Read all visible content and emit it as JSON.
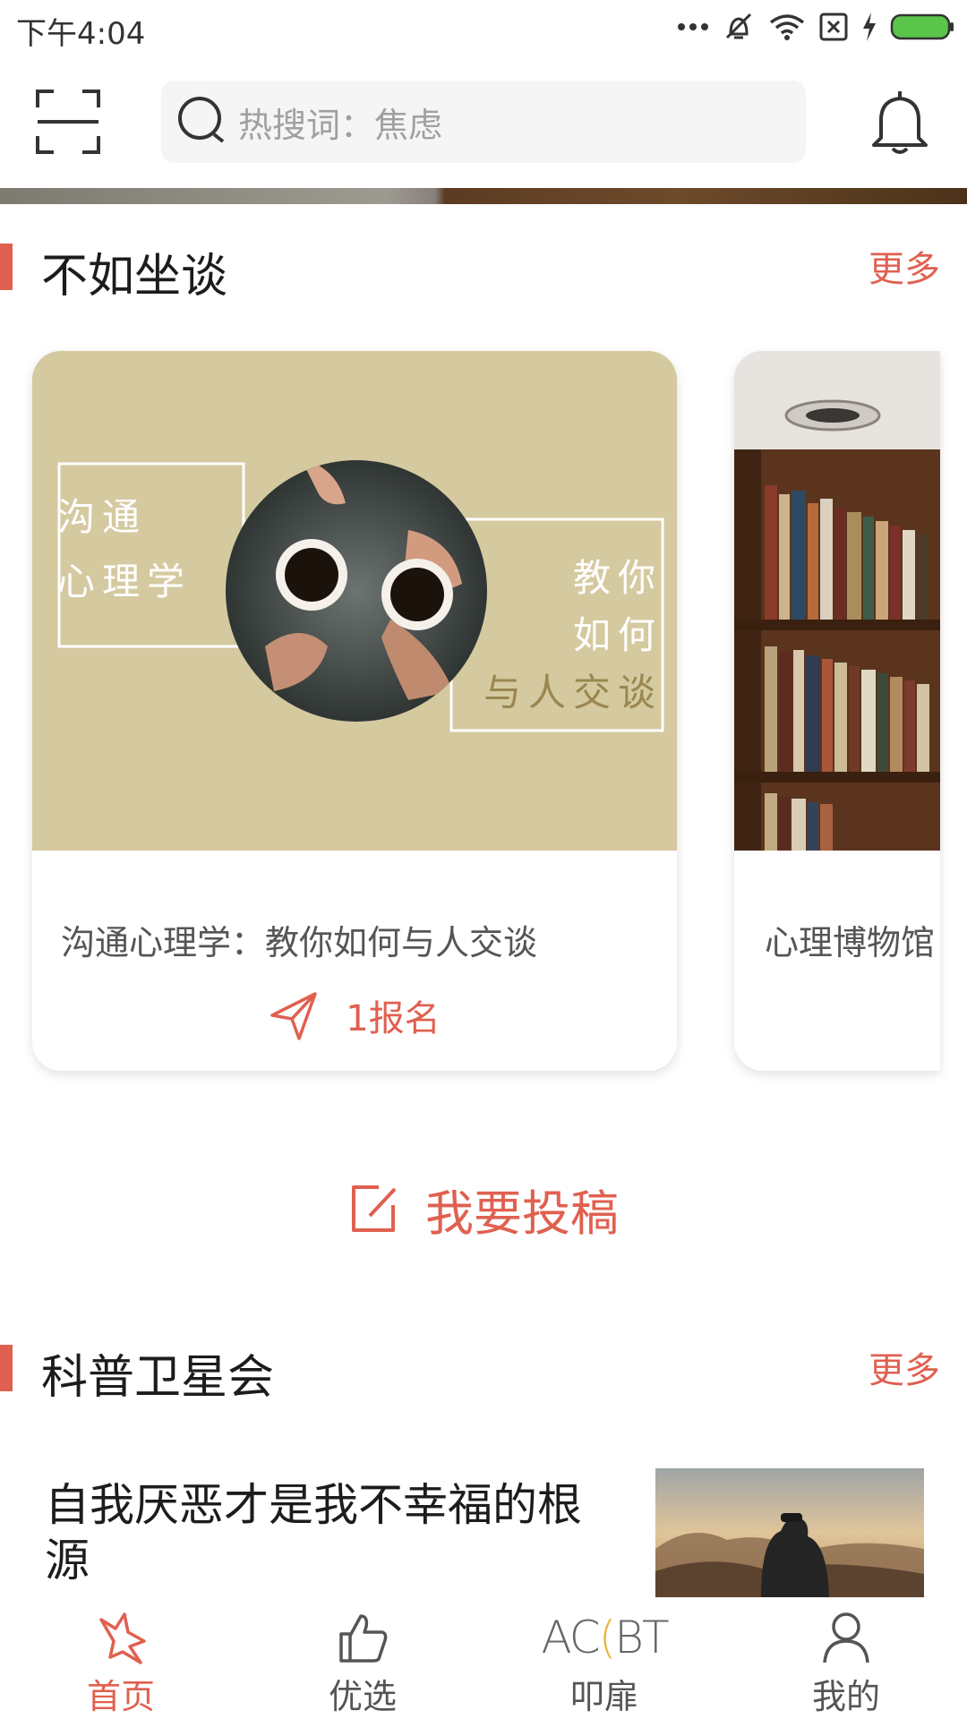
{
  "status_bar": {
    "time": "下午4:04"
  },
  "search": {
    "placeholder": "热搜词：焦虑"
  },
  "sections": {
    "talk": {
      "title": "不如坐谈",
      "more": "更多"
    },
    "science": {
      "title": "科普卫星会",
      "more": "更多"
    }
  },
  "cards": [
    {
      "title": "沟通心理学：教你如何与人交谈",
      "action": "1报名",
      "image_text_left": [
        "沟通",
        "心理学"
      ],
      "image_text_right": [
        "教你",
        "如何",
        "与人交谈"
      ]
    },
    {
      "title": "心理博物馆"
    }
  ],
  "submit": {
    "label": "我要投稿"
  },
  "article": {
    "title": "自我厌恶才是我不幸福的根源"
  },
  "nav": {
    "items": [
      {
        "label": "首页",
        "icon": "home-star-icon",
        "active": true
      },
      {
        "label": "优选",
        "icon": "thumbs-up-icon",
        "active": false
      },
      {
        "label": "叩扉",
        "icon": "acbt-logo",
        "logo_text": "ACBT",
        "active": false
      },
      {
        "label": "我的",
        "icon": "person-icon",
        "active": false
      }
    ]
  },
  "colors": {
    "accent": "#e06050",
    "card_beige": "#d5c9a0"
  }
}
